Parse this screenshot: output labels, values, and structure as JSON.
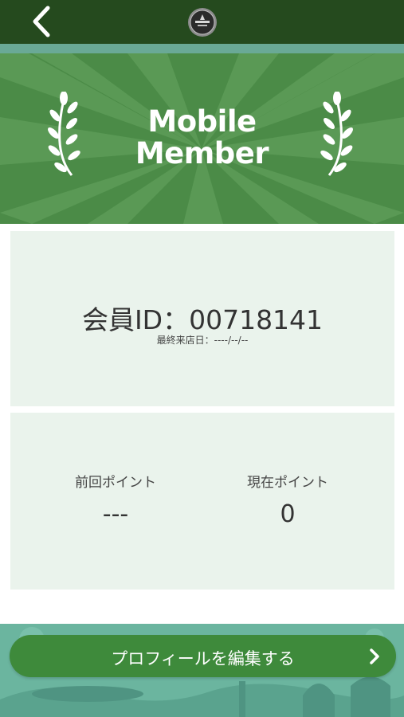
{
  "header": {
    "back_icon": "chevron-left-icon",
    "logo_icon": "store-logo-icon"
  },
  "banner": {
    "title_line1": "Mobile",
    "title_line2": "Member"
  },
  "member": {
    "id_text": "会員ID：00718141",
    "last_visit": "最終来店日：----/--/--"
  },
  "points": {
    "previous_label": "前回ポイント",
    "previous_value": "---",
    "current_label": "現在ポイント",
    "current_value": "0"
  },
  "footer": {
    "edit_profile_label": "プロフィールを編集する",
    "chevron_icon": "chevron-right-icon"
  },
  "colors": {
    "topbar": "#254a1e",
    "banner": "#4b8b47",
    "card": "#eaf3ec",
    "button": "#3e8a3b",
    "footer": "#6bb59f"
  }
}
